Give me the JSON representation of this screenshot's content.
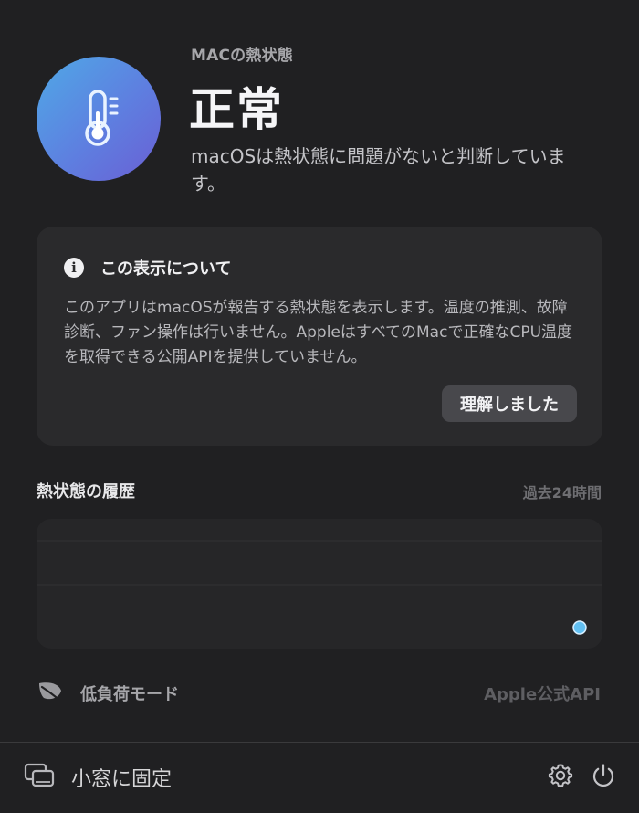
{
  "header": {
    "eyebrow": "MACの熱状態",
    "status": "正常",
    "description": "macOSは熱状態に問題がないと判断しています。",
    "icon": "thermometer-icon",
    "accent_gradient": [
      "#4fa9e6",
      "#6a5fd4"
    ]
  },
  "info_card": {
    "icon": "info-icon",
    "title": "この表示について",
    "body": "このアプリはmacOSが報告する熱状態を表示します。温度の推測、故障診断、ファン操作は行いません。AppleはすべてのMacで正確なCPU温度を取得できる公開APIを提供していません。",
    "button_label": "理解しました"
  },
  "history": {
    "title": "熱状態の履歴",
    "range_label": "過去24時間",
    "line_colors": [
      "#5ab8f0",
      "#6f78e8"
    ]
  },
  "low_power": {
    "icon": "leaf-icon",
    "label": "低負荷モード"
  },
  "source": {
    "label": "Apple公式API"
  },
  "footer": {
    "pin_icon": "pip-window-icon",
    "pin_label": "小窓に固定",
    "settings_icon": "gear-icon",
    "power_icon": "power-icon"
  }
}
